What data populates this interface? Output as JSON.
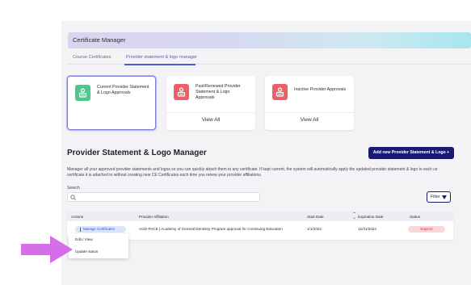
{
  "app": {
    "title": "Certificate Manager"
  },
  "tabs": [
    {
      "label": "Course Certificates",
      "active": false
    },
    {
      "label": "Provider statement & logo manager",
      "active": true
    }
  ],
  "cards": [
    {
      "title": "Current Provider Statement & Logo Approvals",
      "view_all": "",
      "icon": "certificate-icon",
      "color": "#4cc98a",
      "selected": true
    },
    {
      "title": "Past/Renewed Provider Statement & Logo Approvals",
      "view_all": "View All",
      "icon": "certificate-icon",
      "color": "#ef5d67",
      "selected": false
    },
    {
      "title": "Inactive Provider Approvals",
      "view_all": "View All",
      "icon": "certificate-icon",
      "color": "#ef5d67",
      "selected": false
    }
  ],
  "section": {
    "title": "Provider Statement & Logo Manager",
    "add_button": "Add new Provider Statement & Logo +",
    "description_line1": "Manager all your approved provider statements and logos so you can quickly attach them to any certificate. If kept current, the system will automatically apply the updated provider statement & logo to each ce",
    "description_line2": "certificate it is attached to without creating new CE Certificates each time you renew your provider affiliations."
  },
  "search": {
    "label": "Search",
    "placeholder": ""
  },
  "filter": {
    "label": "Filter"
  },
  "table": {
    "headers": [
      "Actions",
      "Provider Affiliation",
      "Start Date",
      "Expiration Date",
      "Status"
    ],
    "rows": [
      {
        "action": "Manage Certificates",
        "affiliation": "AGD-PACE | Academy of General Dentistry Program approval for Continuing Education",
        "start_date": "1/1/2022",
        "expiration_date": "12/31/2024",
        "status": "Expired"
      }
    ]
  },
  "dropdown": {
    "items": [
      "Edit / View",
      "Update status"
    ]
  },
  "colors": {
    "accent": "#1a1a73",
    "link": "#4a5bd8",
    "expired": "#c13838",
    "pointer_arrow": "#d56ee8"
  }
}
